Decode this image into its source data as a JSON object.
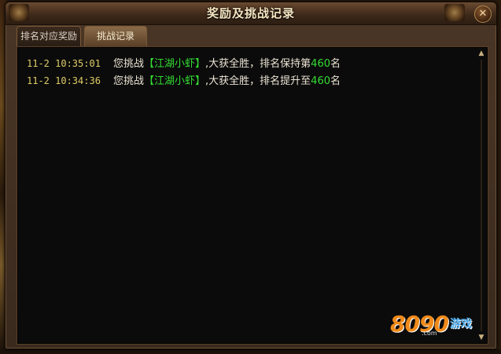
{
  "window": {
    "title": "奖励及挑战记录",
    "close_glyph": "✕"
  },
  "tabs": [
    {
      "label": "排名对应奖励",
      "active": false
    },
    {
      "label": "挑战记录",
      "active": true
    }
  ],
  "log": [
    {
      "time": "11-2 10:35:01",
      "prefix": "您挑战",
      "opponent": "【江湖小虾】",
      "middle": ",大获全胜，排名保持第",
      "rank": "460",
      "suffix": "名"
    },
    {
      "time": "11-2 10:34:36",
      "prefix": "您挑战",
      "opponent": "【江湖小虾】",
      "middle": ",大获全胜，排名提升至",
      "rank": "460",
      "suffix": "名"
    }
  ],
  "scrollbar": {
    "up_glyph": "▲",
    "down_glyph": "▼"
  },
  "watermark": {
    "number": "8090",
    "domain": ".com",
    "text": "游戏"
  },
  "colors": {
    "time": "#e0cc66",
    "highlight": "#33dd33",
    "text": "#ece4d4",
    "title": "#f4e4c0"
  }
}
